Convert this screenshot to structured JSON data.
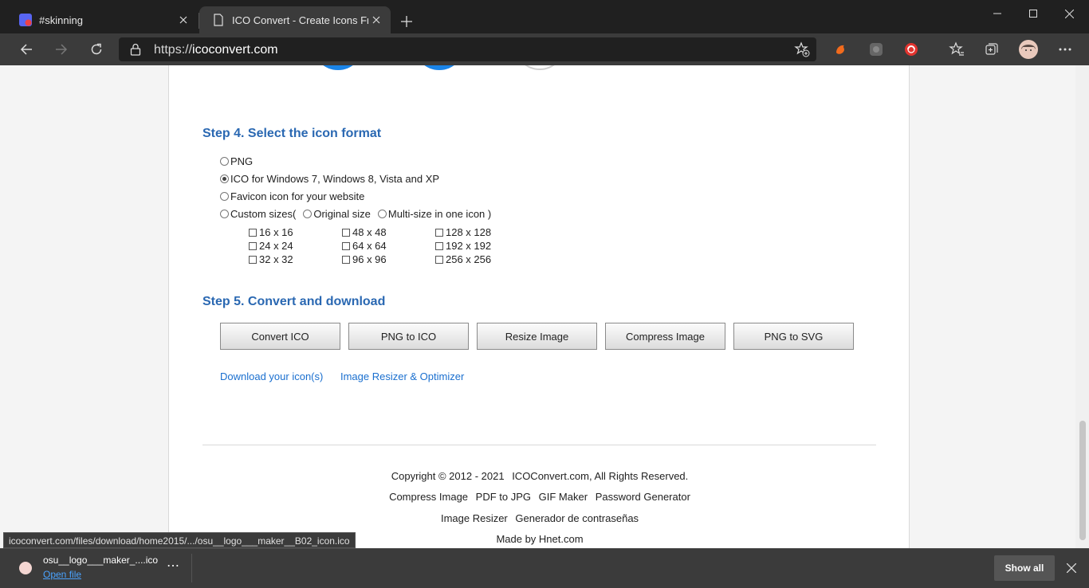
{
  "browser": {
    "tabs": [
      {
        "title": "#skinning",
        "active": false
      },
      {
        "title": "ICO Convert - Create Icons From",
        "active": true
      }
    ],
    "url_scheme": "https://",
    "url_host": "icoconvert.com",
    "accent": "#f26b1d"
  },
  "page": {
    "step4": {
      "title": "Step 4. Select the icon format",
      "options": [
        {
          "label": "PNG",
          "selected": false
        },
        {
          "label": "ICO for Windows 7, Windows 8, Vista and XP",
          "selected": true
        },
        {
          "label": "Favicon icon for your website",
          "selected": false
        }
      ],
      "custom": {
        "label": "Custom sizes(",
        "original": "Original size",
        "multi": "Multi-size in one icon )"
      },
      "sizes": [
        [
          "16 x 16",
          "48 x 48",
          "128 x 128"
        ],
        [
          "24 x 24",
          "64 x 64",
          "192 x 192"
        ],
        [
          "32 x 32",
          "96 x 96",
          "256 x 256"
        ]
      ]
    },
    "step5": {
      "title": "Step 5. Convert and download",
      "buttons": [
        "Convert ICO",
        "PNG to ICO",
        "Resize Image",
        "Compress Image",
        "PNG to SVG"
      ],
      "links": [
        "Download your icon(s)",
        "Image Resizer & Optimizer"
      ]
    },
    "footer": {
      "copyright": "Copyright © 2012 - 2021",
      "rights": "ICOConvert.com, All Rights Reserved.",
      "links1": [
        "Compress Image",
        "PDF to JPG",
        "GIF Maker",
        "Password Generator"
      ],
      "links2": [
        "Image Resizer",
        "Generador de contraseñas"
      ],
      "made_by": "Made by Hnet.com"
    },
    "link_color": "#1a6fcf",
    "heading_color": "#2a68b2"
  },
  "status_url": "icoconvert.com/files/download/home2015/.../osu__logo___maker__B02_icon.ico",
  "download": {
    "file_name": "osu__logo___maker_....ico",
    "open_label": "Open file",
    "show_all": "Show all"
  }
}
